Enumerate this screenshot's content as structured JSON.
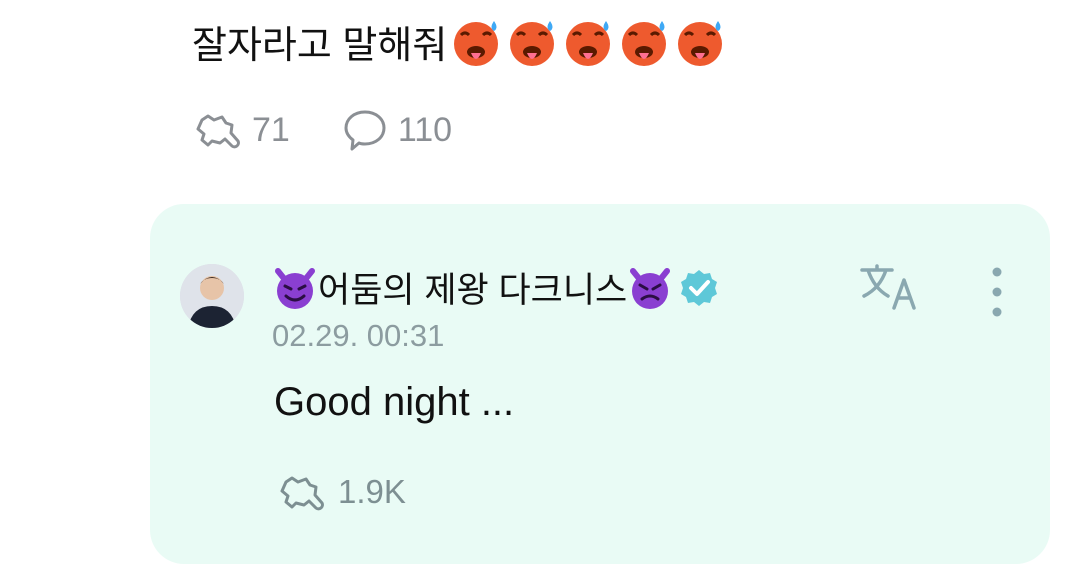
{
  "post": {
    "text": "잘자라고 말해줘",
    "emoji_count": 5,
    "emoji_icon": "hot-face-emoji",
    "likes_count": "71",
    "comments_count": "110"
  },
  "comment": {
    "author_name": "어둠의 제왕 다크니스",
    "timestamp": "02.29. 00:31",
    "body": "Good night ...",
    "likes_count": "1.9K",
    "verified": true
  },
  "icons": {
    "like": "clap-icon",
    "comment": "speech-bubble-icon",
    "translate": "translate-icon",
    "more": "more-vertical-icon",
    "verified": "verified-badge-icon",
    "author_emoji": "smiling-devil-emoji"
  },
  "colors": {
    "card_background": "#e9fbf5",
    "meta_gray": "#8b8f94",
    "verified_teal": "#5ec8d8",
    "devil_purple": "#8a3fd1"
  }
}
